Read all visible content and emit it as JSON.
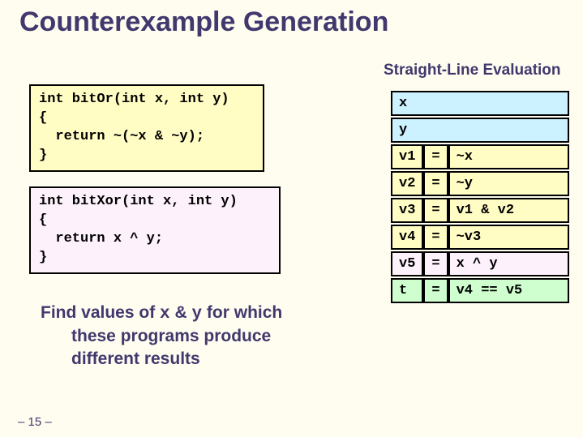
{
  "title": "Counterexample Generation",
  "subtitle": "Straight-Line Evaluation",
  "code1": "int bitOr(int x, int y)\n{\n  return ~(~x & ~y);\n}",
  "code2": "int bitXor(int x, int y)\n{\n  return x ^ y;\n}",
  "caption": {
    "line1a": "Find values of ",
    "mono1": "x",
    "mid": " & ",
    "mono2": "y",
    "line1b": " for which",
    "line2": "these programs produce",
    "line3": "different results"
  },
  "table": {
    "r0": {
      "var": "x",
      "eq": "",
      "expr": ""
    },
    "r1": {
      "var": "y",
      "eq": "",
      "expr": ""
    },
    "r2": {
      "var": "v1",
      "eq": "=",
      "expr": "~x"
    },
    "r3": {
      "var": "v2",
      "eq": "=",
      "expr": "~y"
    },
    "r4": {
      "var": "v3",
      "eq": "=",
      "expr": "v1 & v2"
    },
    "r5": {
      "var": "v4",
      "eq": "=",
      "expr": "~v3"
    },
    "r6": {
      "var": "v5",
      "eq": "=",
      "expr": "x ^ y"
    },
    "r7": {
      "var": "t",
      "eq": "=",
      "expr": "v4 == v5"
    }
  },
  "footer": "– 15 –"
}
